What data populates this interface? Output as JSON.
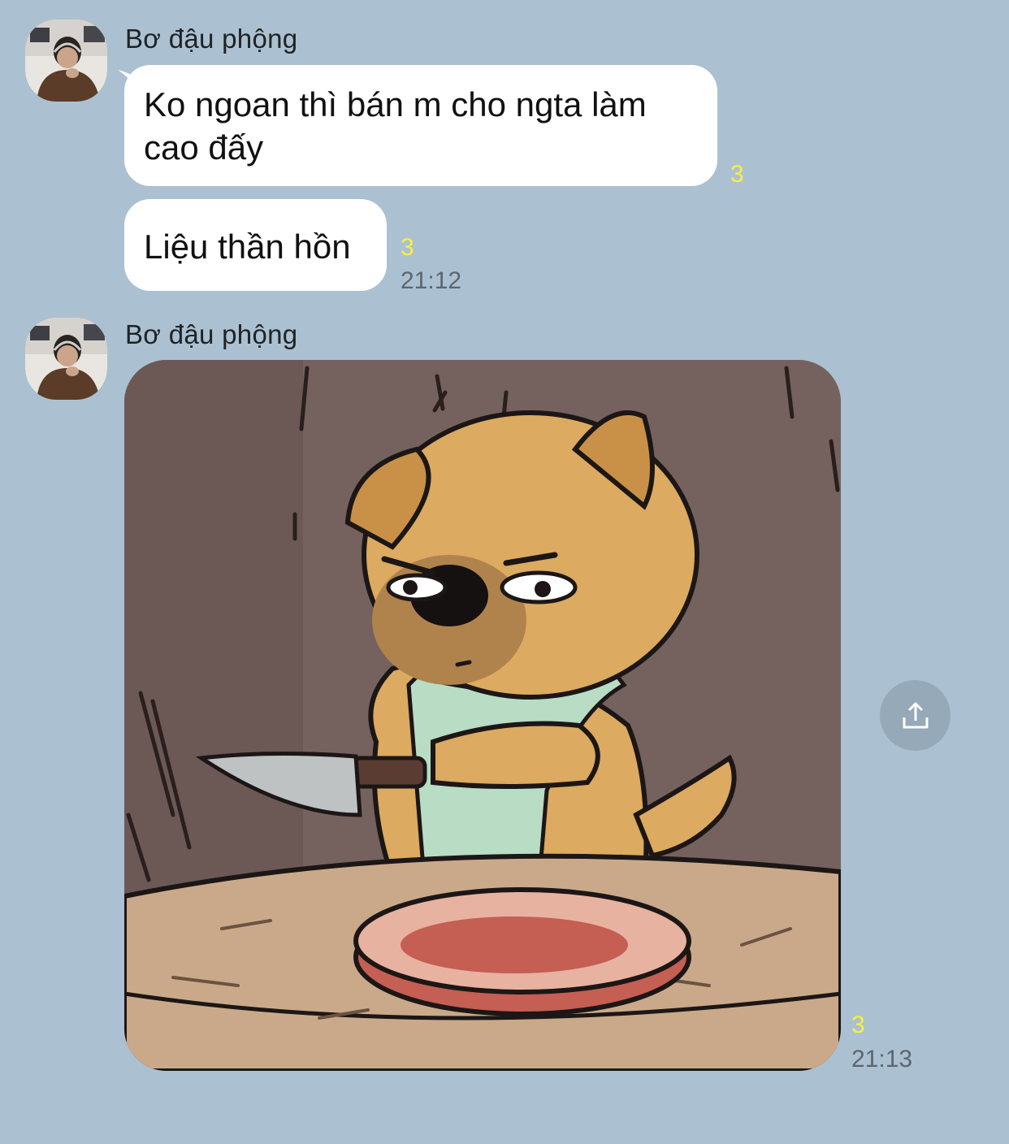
{
  "messages": [
    {
      "sender": "Bơ đậu phộng",
      "bubbles": [
        {
          "text": "Ko ngoan thì bán m cho ngta làm cao đấy",
          "unread": "3"
        },
        {
          "text": "Liệu thần hồn",
          "unread": "3",
          "time": "21:12"
        }
      ]
    },
    {
      "sender": "Bơ đậu phộng",
      "sticker": {
        "description_icon": "dog-with-knife-sticker"
      },
      "unread": "3",
      "time": "21:13"
    }
  ],
  "icons": {
    "share": "share-icon",
    "avatar": "avatar"
  },
  "colors": {
    "background": "#abc1d1",
    "bubble": "#ffffff",
    "unread": "#fbee3c",
    "time": "#5b6670",
    "share_button": "#96a9b9"
  }
}
